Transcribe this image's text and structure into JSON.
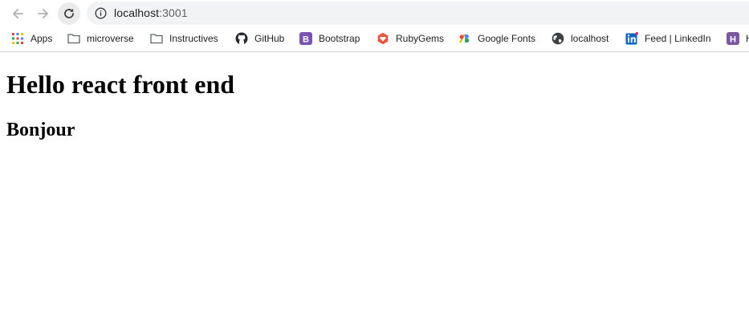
{
  "browser": {
    "url_host": "localhost",
    "url_port": ":3001",
    "icons": {
      "back": "arrow-left-icon",
      "forward": "arrow-right-icon",
      "reload": "reload-icon",
      "site_info": "info-icon"
    }
  },
  "bookmarks": [
    {
      "label": "Apps",
      "icon": "apps-grid-icon"
    },
    {
      "label": "microverse",
      "icon": "folder-icon"
    },
    {
      "label": "Instructives",
      "icon": "folder-icon"
    },
    {
      "label": "GitHub",
      "icon": "github-icon"
    },
    {
      "label": "Bootstrap",
      "icon": "bootstrap-icon"
    },
    {
      "label": "RubyGems",
      "icon": "rubygems-icon"
    },
    {
      "label": "Google Fonts",
      "icon": "google-fonts-icon"
    },
    {
      "label": "localhost",
      "icon": "globe-icon"
    },
    {
      "label": "Feed | LinkedIn",
      "icon": "linkedin-icon"
    },
    {
      "label": "H",
      "icon": "heroku-icon"
    }
  ],
  "page": {
    "heading": "Hello react front end",
    "subheading": "Bonjour"
  },
  "colors": {
    "omnibox_bg": "#f1f3f4",
    "bootstrap": "#7952b3",
    "rubygems": "#e9573f",
    "linkedin": "#0a66c2",
    "heroku": "#79589f"
  }
}
